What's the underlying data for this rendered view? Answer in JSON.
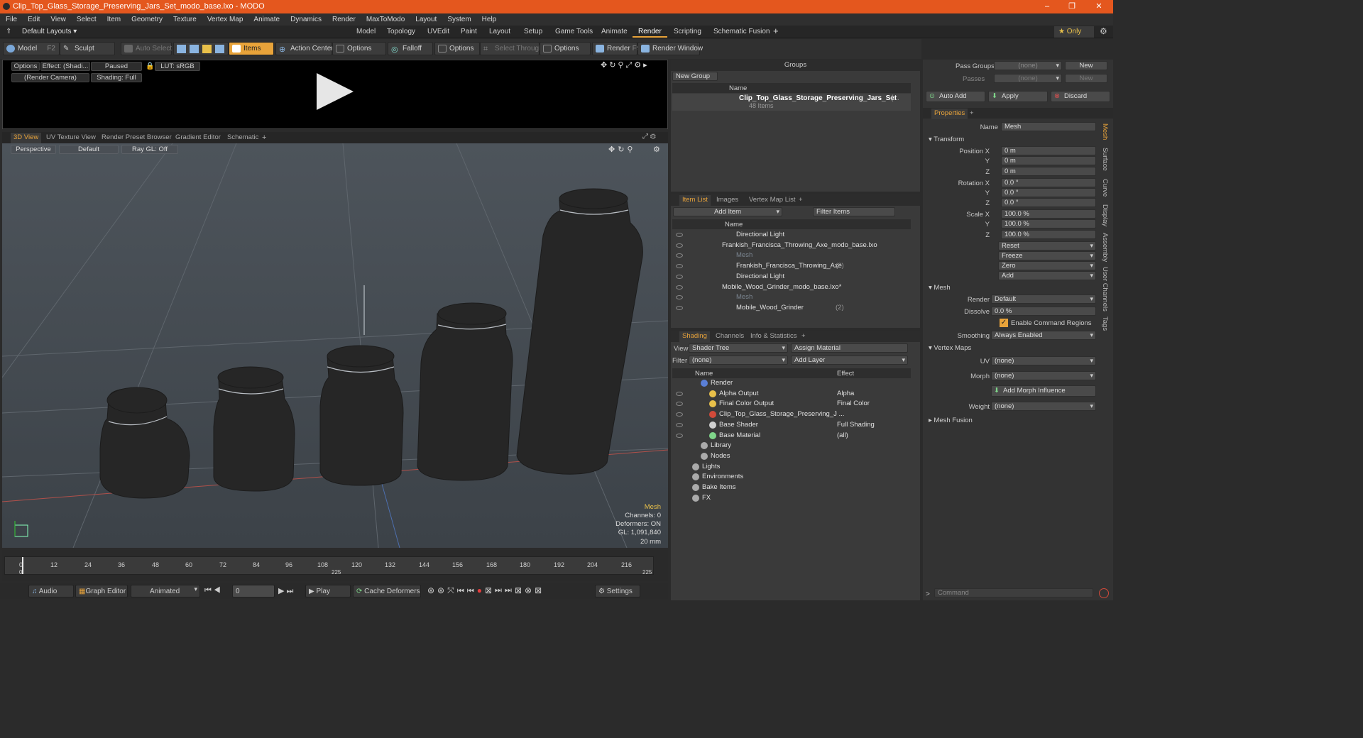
{
  "window": {
    "title": "Clip_Top_Glass_Storage_Preserving_Jars_Set_modo_base.lxo - MODO",
    "minimize": "–",
    "maximize": "❐",
    "close": "✕"
  },
  "menu": [
    "File",
    "Edit",
    "View",
    "Select",
    "Item",
    "Geometry",
    "Texture",
    "Vertex Map",
    "Animate",
    "Dynamics",
    "Render",
    "MaxToModo",
    "Layout",
    "System",
    "Help"
  ],
  "layouts": {
    "preset": "Default Layouts",
    "tabs": [
      "Model",
      "Topology",
      "UVEdit",
      "Paint",
      "Layout",
      "Setup",
      "Game Tools",
      "Animate",
      "Render",
      "Scripting",
      "Schematic Fusion"
    ],
    "active": "Render",
    "plus": "+",
    "only": "★  Only"
  },
  "toolbar": {
    "model": "Model",
    "model_key": "F2",
    "sculpt": "Sculpt",
    "auto_select": "Auto Select",
    "items": "Items",
    "action_center": "Action Center",
    "options1": "Options",
    "falloff": "Falloff",
    "options2": "Options",
    "select_through": "Select Through",
    "options3": "Options",
    "render": "Render",
    "render_key": "F9",
    "render_window": "Render Window"
  },
  "preview": {
    "options": "Options",
    "effect": "Effect: (Shadi...",
    "paused": "Paused",
    "lut": "LUT: sRGB",
    "camera": "(Render Camera)",
    "shading": "Shading: Full"
  },
  "viewport": {
    "tabs": [
      "3D View",
      "UV Texture View",
      "Render Preset Browser",
      "Gradient Editor",
      "Schematic"
    ],
    "plus": "+",
    "perspective": "Perspective",
    "default": "Default",
    "raygl": "Ray GL: Off",
    "info": {
      "selection": "Mesh",
      "channels": "Channels: 0",
      "deformers": "Deformers: ON",
      "gl": "GL: 1,091,840",
      "size": "20 mm"
    }
  },
  "timeline": {
    "ticks": [
      "0",
      "12",
      "24",
      "36",
      "48",
      "60",
      "72",
      "84",
      "96",
      "108",
      "120",
      "132",
      "144",
      "156",
      "168",
      "180",
      "192",
      "204",
      "216"
    ],
    "sub_left": "0",
    "sub_mid": "225",
    "sub_right": "225"
  },
  "bottom": {
    "audio": "Audio",
    "graph_editor": "Graph Editor",
    "animated": "Animated",
    "frame": "0",
    "play": "Play",
    "cache": "Cache Deformers",
    "settings": "Settings"
  },
  "groups": {
    "title": "Groups",
    "new_group": "New Group",
    "col_name": "Name",
    "group_name": "Clip_Top_Glass_Storage_Preserving_Jars_Set",
    "group_suffix": "(...",
    "group_count": "48 Items"
  },
  "itemlist": {
    "tabs": [
      "Item List",
      "Images",
      "Vertex Map List"
    ],
    "plus": "+",
    "add_item": "Add Item",
    "filter": "Filter Items",
    "col_name": "Name",
    "rows": [
      {
        "label": "Directional Light",
        "indent": 3,
        "dim": false
      },
      {
        "label": "Frankish_Francisca_Throwing_Axe_modo_base.lxo",
        "indent": 1,
        "dim": false
      },
      {
        "label": "Mesh",
        "indent": 3,
        "dim": true
      },
      {
        "label": "Frankish_Francisca_Throwing_Axe",
        "suffix": "(2)",
        "indent": 3,
        "dim": false
      },
      {
        "label": "Directional Light",
        "indent": 3,
        "dim": false
      },
      {
        "label": "Mobile_Wood_Grinder_modo_base.lxo*",
        "indent": 1,
        "dim": false
      },
      {
        "label": "Mesh",
        "indent": 3,
        "dim": true
      },
      {
        "label": "Mobile_Wood_Grinder",
        "suffix": "(2)",
        "indent": 3,
        "dim": false
      }
    ]
  },
  "shading": {
    "tabs": [
      "Shading",
      "Channels",
      "Info & Statistics"
    ],
    "plus": "+",
    "view_label": "View",
    "view_value": "Shader Tree",
    "assign": "Assign Material",
    "filter_label": "Filter",
    "filter_value": "(none)",
    "add_layer": "Add Layer",
    "col_name": "Name",
    "col_effect": "Effect",
    "rows": [
      {
        "label": "Render",
        "effect": "",
        "indent": 0
      },
      {
        "label": "Alpha Output",
        "effect": "Alpha",
        "indent": 1
      },
      {
        "label": "Final Color Output",
        "effect": "Final Color",
        "indent": 1
      },
      {
        "label": "Clip_Top_Glass_Storage_Preserving_J ...",
        "effect": "",
        "indent": 1
      },
      {
        "label": "Base Shader",
        "effect": "Full Shading",
        "indent": 1
      },
      {
        "label": "Base Material",
        "effect": "(all)",
        "indent": 1
      },
      {
        "label": "Library",
        "effect": "",
        "indent": 0
      },
      {
        "label": "Nodes",
        "effect": "",
        "indent": 0
      },
      {
        "label": "Lights",
        "effect": "",
        "indent": -1
      },
      {
        "label": "Environments",
        "effect": "",
        "indent": -1
      },
      {
        "label": "Bake Items",
        "effect": "",
        "indent": -1
      },
      {
        "label": "FX",
        "effect": "",
        "indent": -1
      }
    ]
  },
  "props": {
    "pass_groups": "Pass Groups",
    "passes": "Passes",
    "none": "(none)",
    "new": "New",
    "auto_add": "Auto Add",
    "apply": "Apply",
    "discard": "Discard",
    "tab": "Properties",
    "plus": "+",
    "name_label": "Name",
    "name_value": "Mesh",
    "transform": "Transform",
    "position_x": "Position X",
    "rotation_x": "Rotation X",
    "scale_x": "Scale X",
    "y": "Y",
    "z": "Z",
    "pos": [
      "0 m",
      "0 m",
      "0 m"
    ],
    "rot": [
      "0.0 °",
      "0.0 °",
      "0.0 °"
    ],
    "scl": [
      "100.0 %",
      "100.0 %",
      "100.0 %"
    ],
    "reset": "Reset",
    "freeze": "Freeze",
    "zero": "Zero",
    "add": "Add",
    "mesh": "Mesh",
    "render_label": "Render",
    "render_value": "Default",
    "dissolve_label": "Dissolve",
    "dissolve_value": "0.0 %",
    "enable_cmd": "Enable Command Regions",
    "smoothing_label": "Smoothing",
    "smoothing_value": "Always Enabled",
    "vertex_maps": "Vertex Maps",
    "uv_label": "UV",
    "uv_value": "(none)",
    "morph_label": "Morph",
    "morph_value": "(none)",
    "add_morph": "Add Morph Influence",
    "weight_label": "Weight",
    "weight_value": "(none)",
    "mesh_fusion": "Mesh Fusion",
    "side_tabs": [
      "Mesh",
      "Surface",
      "Curve",
      "Display",
      "Assembly",
      "User Channels",
      "Tags"
    ],
    "command": "Command"
  },
  "colors": {
    "accent": "#e8a33a",
    "titlebar": "#e4571e"
  }
}
